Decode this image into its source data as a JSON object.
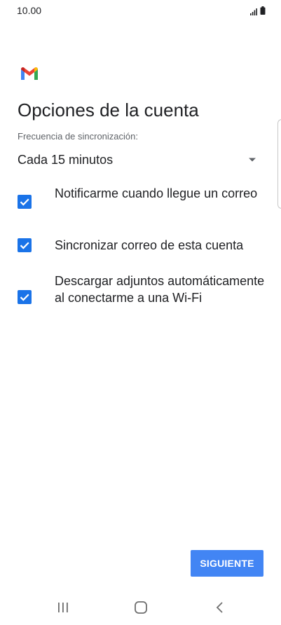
{
  "status_bar": {
    "time": "10.00",
    "icons": [
      "signal-icon",
      "battery-icon"
    ]
  },
  "app": {
    "logo": "gmail-logo"
  },
  "page": {
    "title": "Opciones de la cuenta"
  },
  "sync": {
    "label": "Frecuencia de sincronización:",
    "value": "Cada 15 minutos"
  },
  "options": [
    {
      "label": "Notificarme cuando llegue un correo",
      "checked": true
    },
    {
      "label": "Sincronizar correo de esta cuenta",
      "checked": true
    },
    {
      "label": "Descargar adjuntos automáticamente al conectarme a una Wi-Fi",
      "checked": true
    }
  ],
  "actions": {
    "next_label": "SIGUIENTE"
  },
  "nav_bar": {
    "icons": [
      "recent-apps-icon",
      "home-icon",
      "back-icon"
    ]
  },
  "colors": {
    "checkbox": "#1a73e8",
    "button": "#4285f4",
    "text": "#202124",
    "secondary_text": "#5f6368"
  }
}
